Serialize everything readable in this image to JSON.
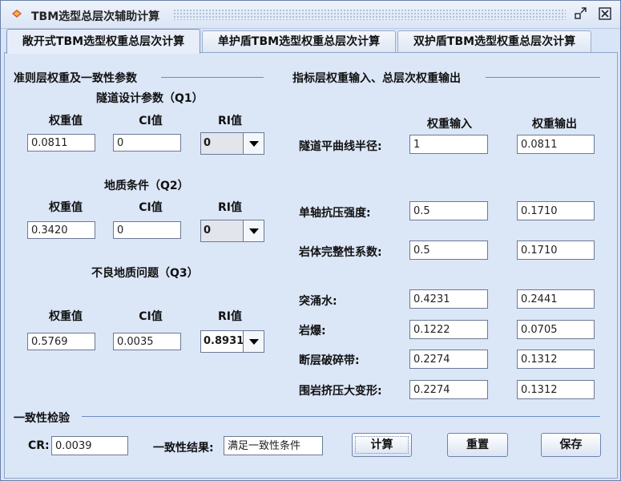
{
  "window": {
    "title": "TBM选型总层次辅助计算",
    "minimize_glyph": "⇱",
    "close_glyph": "☒"
  },
  "tabs": [
    {
      "label": "敞开式TBM选型权重总层次计算",
      "active": true
    },
    {
      "label": "单护盾TBM选型权重总层次计算",
      "active": false
    },
    {
      "label": "双护盾TBM选型权重总层次计算",
      "active": false
    }
  ],
  "left_panel": {
    "section_title": "准则层权重及一致性参数",
    "groups": [
      {
        "title": "隧道设计参数（Q1）",
        "weight_label": "权重值",
        "ci_label": "CI值",
        "ri_label": "RI值",
        "weight": "0.0811",
        "ci": "0",
        "ri": "0"
      },
      {
        "title": "地质条件（Q2）",
        "weight_label": "权重值",
        "ci_label": "CI值",
        "ri_label": "RI值",
        "weight": "0.3420",
        "ci": "0",
        "ri": "0"
      },
      {
        "title": "不良地质问题（Q3）",
        "weight_label": "权重值",
        "ci_label": "CI值",
        "ri_label": "RI值",
        "weight": "0.5769",
        "ci": "0.0035",
        "ri": "0.8931"
      }
    ]
  },
  "right_panel": {
    "section_title": "指标层权重输入、总层次权重输出",
    "input_header": "权重输入",
    "output_header": "权重输出",
    "rows": [
      {
        "label": "隧道平曲线半径:",
        "input": "1",
        "output": "0.0811"
      },
      {
        "label": "单轴抗压强度:",
        "input": "0.5",
        "output": "0.1710"
      },
      {
        "label": "岩体完整性系数:",
        "input": "0.5",
        "output": "0.1710"
      },
      {
        "label": "突涌水:",
        "input": "0.4231",
        "output": "0.2441"
      },
      {
        "label": "岩爆:",
        "input": "0.1222",
        "output": "0.0705"
      },
      {
        "label": "断层破碎带:",
        "input": "0.2274",
        "output": "0.1312"
      },
      {
        "label": "围岩挤压大变形:",
        "input": "0.2274",
        "output": "0.1312"
      }
    ]
  },
  "consistency": {
    "section_title": "一致性检验",
    "cr_label": "CR:",
    "cr_value": "0.0039",
    "result_label": "一致性结果:",
    "result_value": "满足一致性条件"
  },
  "buttons": {
    "calculate": "计算",
    "reset": "重置",
    "save": "保存"
  }
}
